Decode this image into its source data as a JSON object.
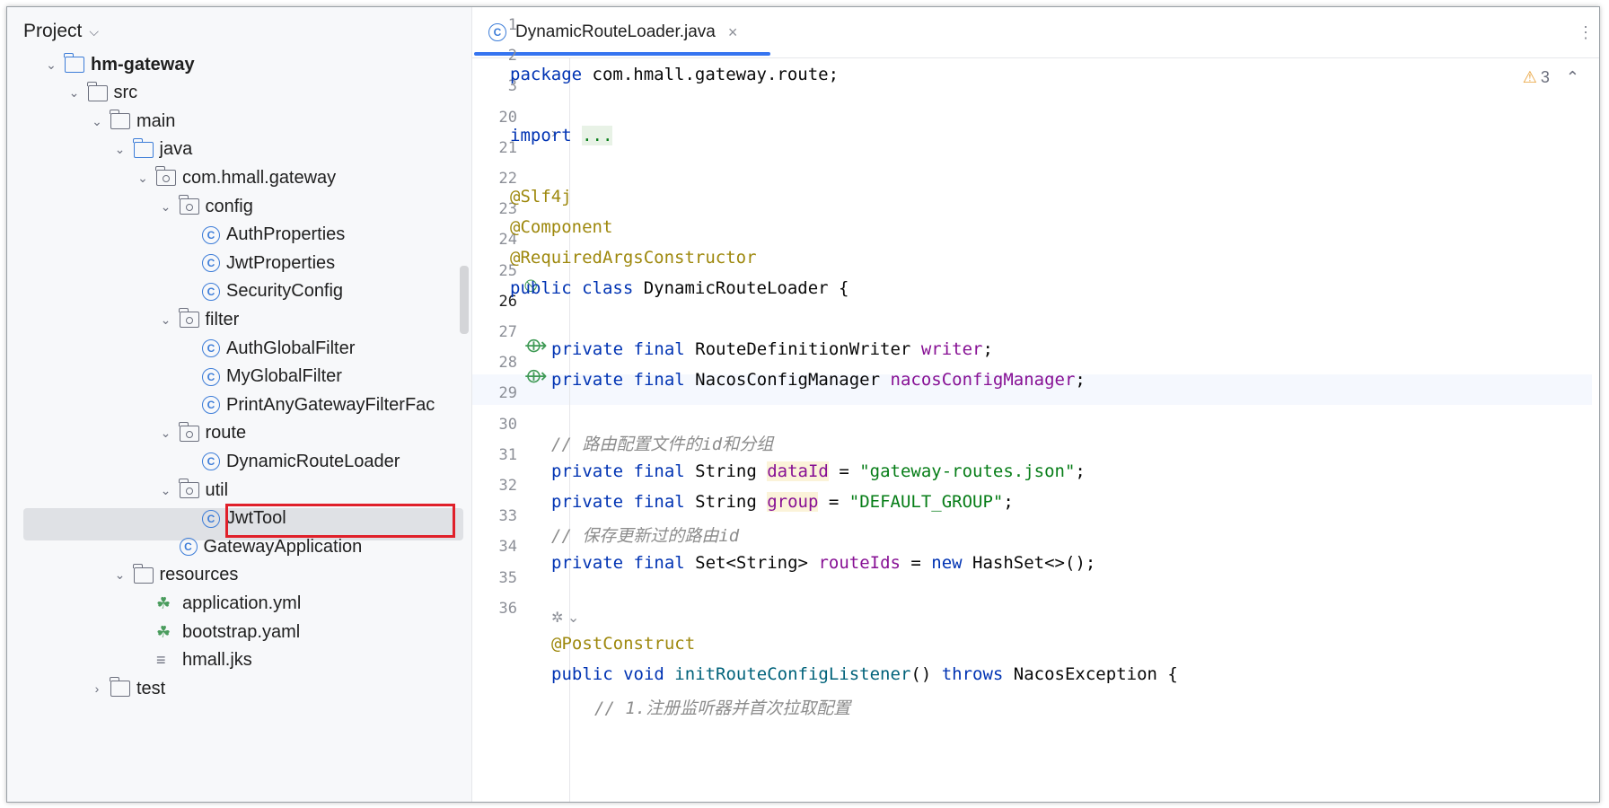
{
  "project_panel": {
    "title": "Project",
    "tree": [
      {
        "label": "hm-gateway",
        "type": "module",
        "depth": 1,
        "expanded": true
      },
      {
        "label": "src",
        "type": "folder",
        "depth": 2,
        "expanded": true
      },
      {
        "label": "main",
        "type": "folder",
        "depth": 3,
        "expanded": true
      },
      {
        "label": "java",
        "type": "folder-blue",
        "depth": 4,
        "expanded": true
      },
      {
        "label": "com.hmall.gateway",
        "type": "package",
        "depth": 5,
        "expanded": true
      },
      {
        "label": "config",
        "type": "package",
        "depth": 6,
        "expanded": true
      },
      {
        "label": "AuthProperties",
        "type": "class",
        "depth": 7
      },
      {
        "label": "JwtProperties",
        "type": "class",
        "depth": 7
      },
      {
        "label": "SecurityConfig",
        "type": "class",
        "depth": 7
      },
      {
        "label": "filter",
        "type": "package",
        "depth": 6,
        "expanded": true
      },
      {
        "label": "AuthGlobalFilter",
        "type": "class",
        "depth": 7
      },
      {
        "label": "MyGlobalFilter",
        "type": "class",
        "depth": 7
      },
      {
        "label": "PrintAnyGatewayFilterFac",
        "type": "class",
        "depth": 7
      },
      {
        "label": "route",
        "type": "package",
        "depth": 6,
        "expanded": true
      },
      {
        "label": "DynamicRouteLoader",
        "type": "class",
        "depth": 7,
        "selected": true
      },
      {
        "label": "util",
        "type": "package",
        "depth": 6,
        "expanded": true
      },
      {
        "label": "JwtTool",
        "type": "class",
        "depth": 7
      },
      {
        "label": "GatewayApplication",
        "type": "app-class",
        "depth": 6
      },
      {
        "label": "resources",
        "type": "resources",
        "depth": 4,
        "expanded": true
      },
      {
        "label": "application.yml",
        "type": "yml",
        "depth": 5
      },
      {
        "label": "bootstrap.yaml",
        "type": "yml",
        "depth": 5
      },
      {
        "label": "hmall.jks",
        "type": "text",
        "depth": 5
      },
      {
        "label": "test",
        "type": "folder",
        "depth": 3,
        "expanded": false
      }
    ]
  },
  "editor": {
    "tab": {
      "label": "DynamicRouteLoader.java",
      "close": "×"
    },
    "inspections": {
      "count": "3"
    },
    "line_numbers": [
      "1",
      "2",
      "3",
      "20",
      "21",
      "22",
      "23",
      "24",
      "25",
      "26",
      "27",
      "28",
      "29",
      "30",
      "31",
      "32",
      "33",
      "34",
      "35",
      "36"
    ],
    "code": {
      "l1_kw": "package",
      "l1_rest": " com.hmall.gateway.route;",
      "l3_kw": "import",
      "l3_fold": "...",
      "l21": "@Slf4j",
      "l22": "@Component",
      "l23": "@RequiredArgsConstructor",
      "l24_kw": "public class",
      "l24_rest": " DynamicRouteLoader {",
      "l26_kw": "private final",
      "l26_type": " RouteDefinitionWriter ",
      "l26_field": "writer",
      "l26_end": ";",
      "l27_kw": "private final",
      "l27_type": " NacosConfigManager ",
      "l27_field": "nacosConfigManager",
      "l27_end": ";",
      "l29": "// 路由配置文件的id和分组",
      "l30_kw": "private final",
      "l30_type": " String ",
      "l30_field": "dataId",
      "l30_eq": " = ",
      "l30_str": "\"gateway-routes.json\"",
      "l30_end": ";",
      "l31_kw": "private final",
      "l31_type": " String ",
      "l31_field": "group",
      "l31_eq": " = ",
      "l31_str": "\"DEFAULT_GROUP\"",
      "l31_end": ";",
      "l32": "// 保存更新过的路由id",
      "l33_kw": "private final",
      "l33_type": " Set<String> ",
      "l33_field": "routeIds",
      "l33_eq": " = ",
      "l33_new": "new",
      "l33_rest": " HashSet<>();",
      "l35": "@PostConstruct",
      "l36_kw": "public void",
      "l36_method": " initRouteConfigListener",
      "l36_paren": "() ",
      "l36_throws": "throws",
      "l36_rest": " NacosException {",
      "l37": "// 1.注册监听器并首次拉取配置"
    }
  }
}
